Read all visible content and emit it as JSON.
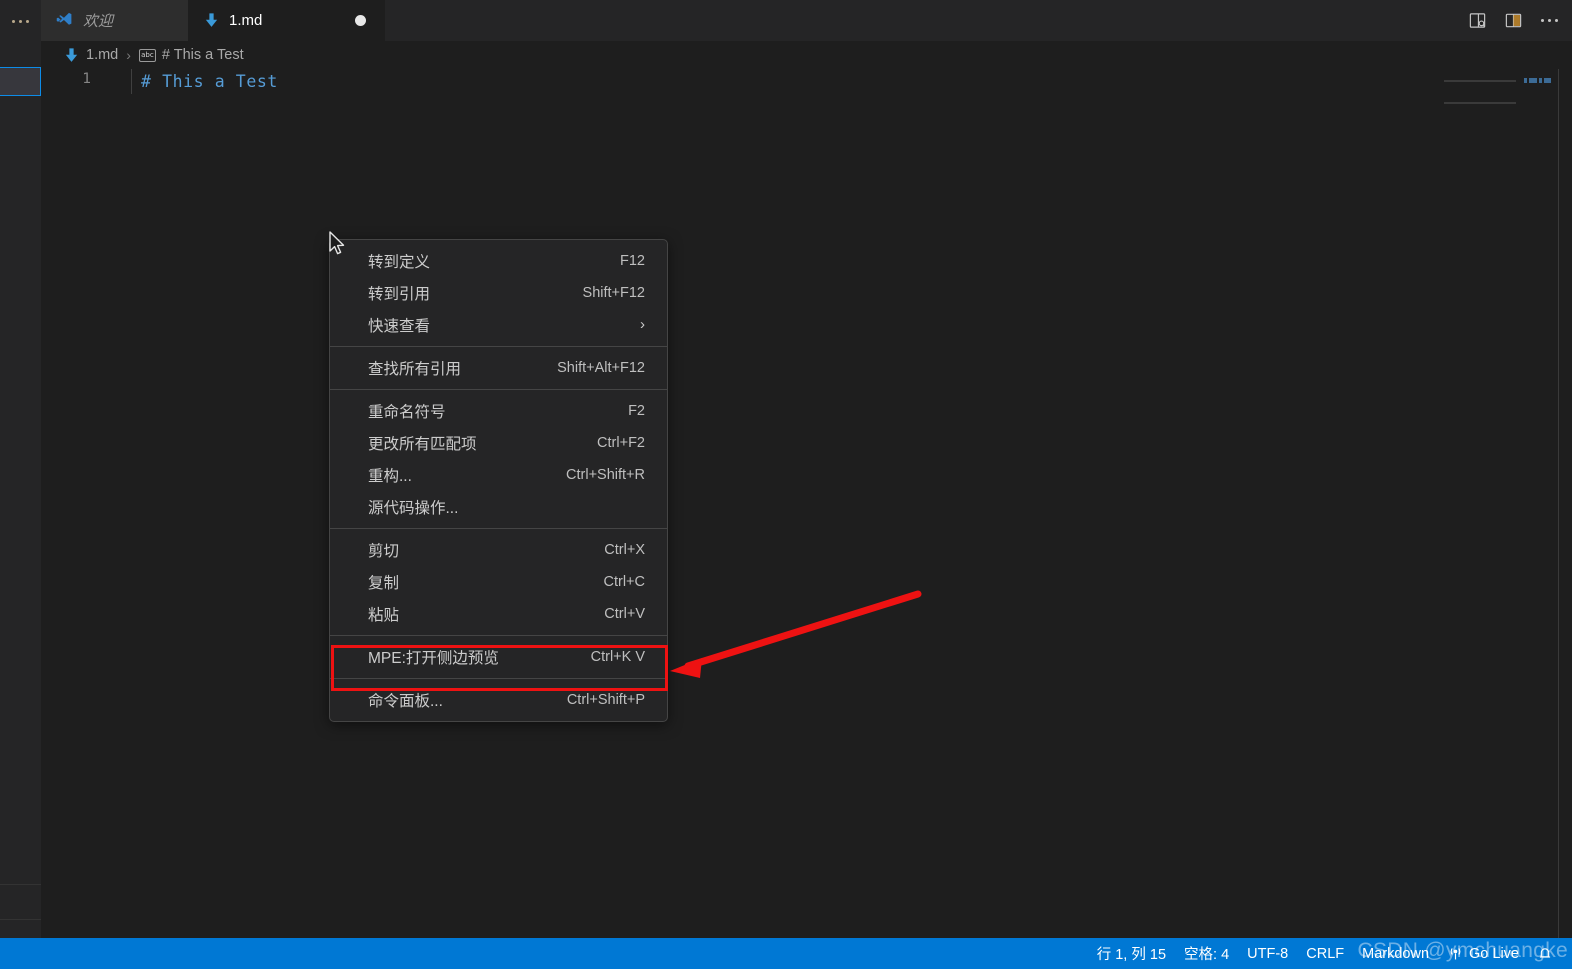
{
  "app": {
    "accent_blue": "#0078d4",
    "editor_bg": "#1e1e1e",
    "chrome_bg": "#252526",
    "annotation_red": "#ee1212"
  },
  "activity_bar": {
    "more_label": "...",
    "focus_box_label": ""
  },
  "tabs": [
    {
      "label": "欢迎",
      "icon": "vscode-logo-icon",
      "active": false,
      "dirty": false
    },
    {
      "label": "1.md",
      "icon": "markdown-down-arrow-icon",
      "active": true,
      "dirty": true
    }
  ],
  "tab_actions": {
    "open_preview_side_label": "open-preview-to-the-side",
    "split_editor_label": "split-editor-right",
    "more_actions_label": "..."
  },
  "breadcrumb": {
    "file": "1.md",
    "separator": "›",
    "symbol_icon_text": "abc",
    "symbol": "# This a Test"
  },
  "editor": {
    "line_number": "1",
    "line_text": "# This a Test"
  },
  "context_menu": {
    "groups": [
      {
        "items": [
          {
            "label": "转到定义",
            "key": "F12",
            "submenu": false
          },
          {
            "label": "转到引用",
            "key": "Shift+F12",
            "submenu": false
          },
          {
            "label": "快速查看",
            "key": "",
            "submenu": true
          }
        ]
      },
      {
        "items": [
          {
            "label": "查找所有引用",
            "key": "Shift+Alt+F12",
            "submenu": false
          }
        ]
      },
      {
        "items": [
          {
            "label": "重命名符号",
            "key": "F2",
            "submenu": false
          },
          {
            "label": "更改所有匹配项",
            "key": "Ctrl+F2",
            "submenu": false
          },
          {
            "label": "重构...",
            "key": "Ctrl+Shift+R",
            "submenu": false
          },
          {
            "label": "源代码操作...",
            "key": "",
            "submenu": false
          }
        ]
      },
      {
        "items": [
          {
            "label": "剪切",
            "key": "Ctrl+X",
            "submenu": false
          },
          {
            "label": "复制",
            "key": "Ctrl+C",
            "submenu": false
          },
          {
            "label": "粘贴",
            "key": "Ctrl+V",
            "submenu": false
          }
        ]
      },
      {
        "items": [
          {
            "label": "MPE:打开侧边预览",
            "key": "Ctrl+K V",
            "submenu": false,
            "highlighted": true
          }
        ]
      },
      {
        "items": [
          {
            "label": "命令面板...",
            "key": "Ctrl+Shift+P",
            "submenu": false
          }
        ]
      }
    ]
  },
  "status_bar": {
    "cursor_position": "行 1, 列 15",
    "indentation": "空格: 4",
    "encoding": "UTF-8",
    "eol": "CRLF",
    "language": "Markdown",
    "go_live": "Go Live",
    "bell_icon": "notifications-bell-icon"
  },
  "watermark": {
    "text": "CSDN @ymchuangke"
  }
}
